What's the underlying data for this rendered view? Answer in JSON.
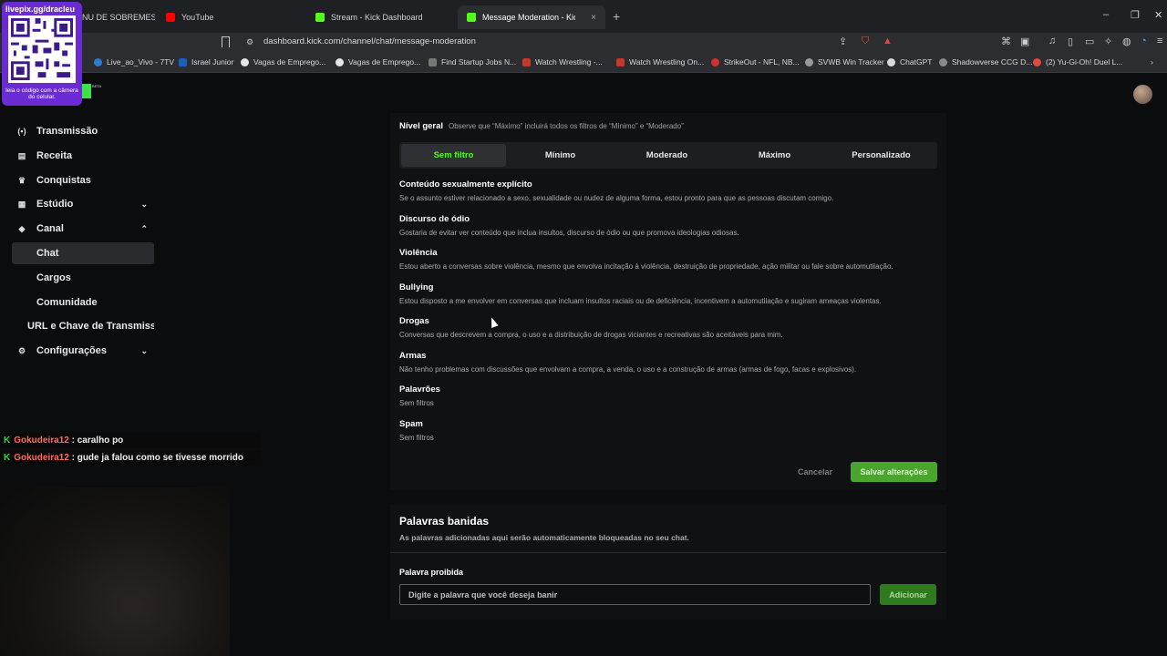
{
  "browser": {
    "tabs": [
      {
        "label": "NU DE SOBREMESA",
        "favicon_color": "#777777"
      },
      {
        "label": "YouTube",
        "favicon_color": "#ff0000"
      },
      {
        "label": "Stream - Kick Dashboard",
        "favicon_color": "#53fc18"
      },
      {
        "label": "Message Moderation - Kick Das",
        "favicon_color": "#53fc18",
        "close": "×"
      }
    ],
    "new_tab": "+",
    "window_controls": [
      "–",
      "❐",
      "✕"
    ],
    "url": "dashboard.kick.com/channel/chat/message-moderation",
    "bookmarks": [
      "Live_ao_Vivo - 7TV",
      "Israel Junior",
      "Vagas de Emprego...",
      "Vagas de Emprego...",
      "Find Startup Jobs N...",
      "Watch Wrestling -...",
      "Watch Wrestling On...",
      "StrikeOut - NFL, NB...",
      "SVWB Win Tracker",
      "ChatGPT",
      "Shadowverse CCG D...",
      "(2) Yu-Gi-Oh! Duel L..."
    ]
  },
  "qr_overlay": {
    "top_text": "livepix.gg/dracleu",
    "caption": "leia o código com a câmera do celular."
  },
  "logo": {
    "beta": "BETA"
  },
  "sidebar": {
    "items": [
      {
        "label": "Transmissão",
        "icon": "broadcast-icon",
        "glyph": "(•)"
      },
      {
        "label": "Receita",
        "icon": "revenue-icon",
        "glyph": "▤"
      },
      {
        "label": "Conquistas",
        "icon": "trophy-icon",
        "glyph": "♛"
      },
      {
        "label": "Estúdio",
        "icon": "studio-icon",
        "glyph": "▦",
        "chevron": "⌄"
      },
      {
        "label": "Canal",
        "icon": "channel-icon",
        "glyph": "◆",
        "chevron": "⌃"
      },
      {
        "label": "Chat"
      },
      {
        "label": "Cargos"
      },
      {
        "label": "Comunidade"
      },
      {
        "label": "URL e Chave de Transmissã"
      },
      {
        "label": "Configurações",
        "icon": "settings-icon",
        "glyph": "⚙",
        "chevron": "⌄"
      }
    ]
  },
  "chat_overlay": {
    "lines": [
      {
        "user": "Gokudeira12",
        "message": " : caralho po"
      },
      {
        "user": "Gokudeira12",
        "message": " : gude ja falou como se tivesse morrido"
      }
    ]
  },
  "moderation": {
    "level_title": "Nível geral",
    "level_hint": "Observe que “Máximo” incluirá todos os filtros de “Mínimo” e “Moderado”",
    "levels": [
      "Sem filtro",
      "Mínimo",
      "Moderado",
      "Máximo",
      "Personalizado"
    ],
    "selected_level": "Sem filtro",
    "filters": [
      {
        "title": "Conteúdo sexualmente explícito",
        "desc": "Se o assunto estiver relacionado a sexo, sexualidade ou nudez de alguma forma, estou pronto para que as pessoas discutam comigo."
      },
      {
        "title": "Discurso de ódio",
        "desc": "Gostaria de evitar ver conteúdo que inclua insultos, discurso de ódio ou que promova ideologias odiosas."
      },
      {
        "title": "Violência",
        "desc": "Estou aberto a conversas sobre violência, mesmo que envolva incitação à violência, destruição de propriedade, ação militar ou fale sobre automutilação."
      },
      {
        "title": "Bullying",
        "desc": "Estou disposto a me envolver em conversas que incluam insultos raciais ou de deficiência, incentivem a automutilação e sugiram ameaças violentas."
      },
      {
        "title": "Drogas",
        "desc": "Conversas que descrevem a compra, o uso e a distribuição de drogas viciantes e recreativas são aceitáveis para mim."
      },
      {
        "title": "Armas",
        "desc": "Não tenho problemas com discussões que envolvam a compra, a venda, o uso e a construção de armas (armas de fogo, facas e explosivos)."
      },
      {
        "title": "Palavrões",
        "desc": "Sem filtros"
      },
      {
        "title": "Spam",
        "desc": "Sem filtros"
      }
    ],
    "cancel_label": "Cancelar",
    "save_label": "Salvar alterações"
  },
  "banned_words": {
    "title": "Palavras banidas",
    "desc": "As palavras adicionadas aqui serão automaticamente bloqueadas no seu chat.",
    "field_label": "Palavra proibida",
    "placeholder": "Digite a palavra que você deseja banir",
    "value": "",
    "add_label": "Adicionar"
  },
  "colors": {
    "accent": "#53fc18",
    "save_bg": "#4aa52c",
    "add_bg": "#2f7a1e",
    "qr_bg": "#6a2bd4"
  }
}
